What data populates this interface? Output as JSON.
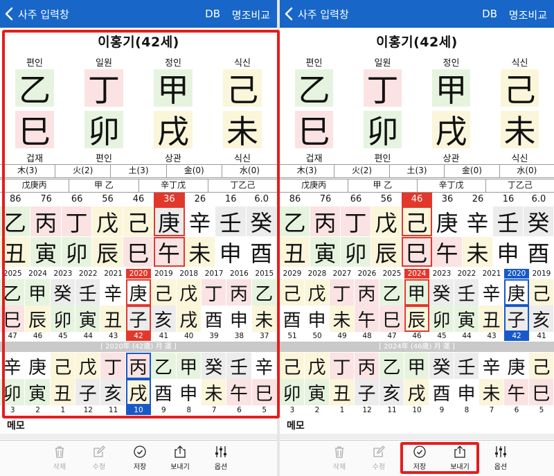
{
  "header": {
    "back_label": "사주 입력창",
    "db_label": "DB",
    "compare_label": "명조비교"
  },
  "left": {
    "title": "이홍기(42세)",
    "top_labels": [
      "편인",
      "일원",
      "정인",
      "식신"
    ],
    "heaven": [
      "乙",
      "丁",
      "甲",
      "己"
    ],
    "earth": [
      "巳",
      "卯",
      "戌",
      "未"
    ],
    "bottom_labels": [
      "겁재",
      "편인",
      "상관",
      "식신"
    ],
    "elements": [
      "木(3)",
      "火(2)",
      "土(3)",
      "金(0)",
      "水(0)"
    ],
    "jijanggan": [
      "戊庚丙",
      "甲 乙",
      "辛丁戊",
      "丁乙己"
    ],
    "daeun_nums": [
      "86",
      "76",
      "66",
      "56",
      "46",
      "36",
      "26",
      "16",
      "6.0"
    ],
    "daeun_top": [
      "乙",
      "丙",
      "丁",
      "戊",
      "己",
      "庚",
      "辛",
      "壬",
      "癸"
    ],
    "daeun_bottom": [
      "丑",
      "寅",
      "卯",
      "辰",
      "巳",
      "午",
      "未",
      "申",
      "酉"
    ],
    "years": [
      "2025",
      "2024",
      "2023",
      "2022",
      "2021",
      "2020",
      "2019",
      "2018",
      "2017",
      "2016",
      "2015"
    ],
    "seun_top": [
      "乙",
      "甲",
      "癸",
      "壬",
      "辛",
      "庚",
      "己",
      "戊",
      "丁",
      "丙",
      "乙"
    ],
    "seun_bottom": [
      "巳",
      "辰",
      "卯",
      "寅",
      "丑",
      "子",
      "亥",
      "戌",
      "酉",
      "申",
      "未"
    ],
    "ages": [
      "47",
      "46",
      "45",
      "44",
      "43",
      "42",
      "41",
      "40",
      "39",
      "38",
      "37"
    ],
    "banner": "[ 2020年 (42歲) 月 運 ]",
    "wolun_top": [
      "辛",
      "庚",
      "己",
      "戊",
      "丁",
      "丙",
      "乙",
      "甲",
      "癸",
      "壬",
      "辛"
    ],
    "wolun_bottom": [
      "卯",
      "寅",
      "丑",
      "子",
      "亥",
      "戌",
      "酉",
      "申",
      "未",
      "午",
      "巳"
    ],
    "months": [
      "3",
      "2",
      "1",
      "12",
      "11",
      "10",
      "9",
      "8",
      "7",
      "6",
      "5"
    ]
  },
  "right": {
    "title": "이홍기(42세)",
    "top_labels": [
      "편인",
      "일원",
      "정인",
      "식신"
    ],
    "heaven": [
      "乙",
      "丁",
      "甲",
      "己"
    ],
    "earth": [
      "巳",
      "卯",
      "戌",
      "未"
    ],
    "bottom_labels": [
      "겁재",
      "편인",
      "상관",
      "식신"
    ],
    "elements": [
      "木(3)",
      "火(2)",
      "土(3)",
      "金(0)",
      "水(0)"
    ],
    "jijanggan": [
      "戊庚丙",
      "甲 乙",
      "辛丁戊",
      "丁乙己"
    ],
    "daeun_nums": [
      "86",
      "76",
      "66",
      "56",
      "46",
      "36",
      "26",
      "16",
      "6.0"
    ],
    "daeun_top": [
      "乙",
      "丙",
      "丁",
      "戊",
      "己",
      "庚",
      "辛",
      "壬",
      "癸"
    ],
    "daeun_bottom": [
      "丑",
      "寅",
      "卯",
      "辰",
      "巳",
      "午",
      "未",
      "申",
      "酉"
    ],
    "years": [
      "2029",
      "2028",
      "2027",
      "2026",
      "2025",
      "2024",
      "2023",
      "2022",
      "2021",
      "2020",
      "2019"
    ],
    "seun_top": [
      "己",
      "戊",
      "丁",
      "丙",
      "乙",
      "甲",
      "癸",
      "壬",
      "辛",
      "庚",
      "己"
    ],
    "seun_bottom": [
      "酉",
      "申",
      "未",
      "午",
      "巳",
      "辰",
      "卯",
      "寅",
      "丑",
      "子",
      "亥"
    ],
    "ages": [
      "51",
      "50",
      "49",
      "48",
      "47",
      "46",
      "45",
      "44",
      "43",
      "42",
      "41"
    ],
    "banner": "[ 2024年 (46歲) 月 運 ]",
    "wolun_top": [
      "己",
      "戊",
      "丁",
      "丙",
      "乙",
      "甲",
      "癸",
      "壬",
      "辛",
      "庚",
      "己"
    ],
    "wolun_bottom": [
      "卯",
      "寅",
      "丑",
      "子",
      "亥",
      "戌",
      "酉",
      "申",
      "未",
      "午",
      "巳"
    ],
    "months": [
      "3",
      "2",
      "1",
      "12",
      "11",
      "10",
      "9",
      "8",
      "7",
      "6",
      "5"
    ]
  },
  "memo_label": "메모",
  "toolbar": {
    "delete": "삭제",
    "edit": "수정",
    "save": "저장",
    "send": "보내기",
    "options": "옵션"
  },
  "colors": {
    "header": "#1766c8",
    "highlight_red": "#e2382c",
    "highlight_blue": "#1759c9",
    "annotation_red": "#e41d1d"
  }
}
